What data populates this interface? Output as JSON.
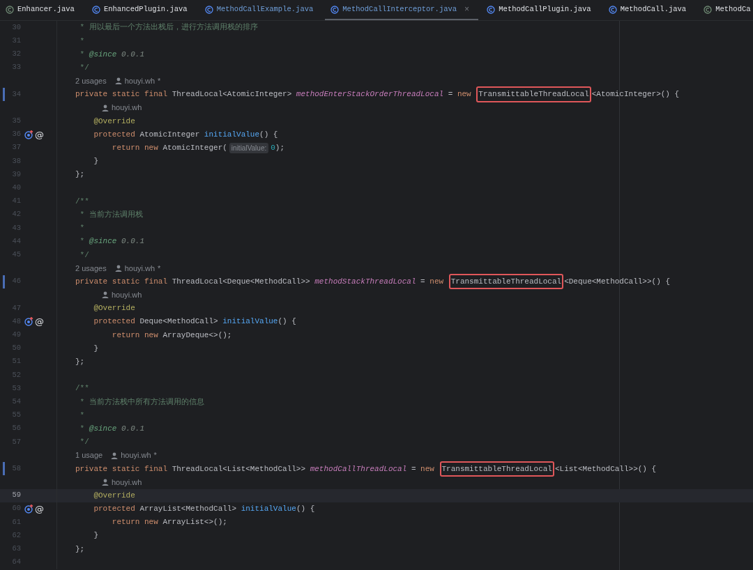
{
  "tabs": [
    {
      "label": "Enhancer.java",
      "kind": "other",
      "modified": false,
      "selected": false
    },
    {
      "label": "EnhancedPlugin.java",
      "kind": "class",
      "modified": false,
      "selected": false
    },
    {
      "label": "MethodCallExample.java",
      "kind": "class",
      "modified": true,
      "selected": false
    },
    {
      "label": "MethodCallInterceptor.java",
      "kind": "class",
      "modified": true,
      "selected": true,
      "close": "×"
    },
    {
      "label": "MethodCallPlugin.java",
      "kind": "class",
      "modified": false,
      "selected": false
    },
    {
      "label": "MethodCall.java",
      "kind": "class",
      "modified": false,
      "selected": false
    },
    {
      "label": "MethodCa",
      "kind": "other",
      "modified": false,
      "selected": false
    }
  ],
  "lines": [
    {
      "kind": "code",
      "number": "30",
      "tokens": [
        {
          "kind": "doc",
          "text": " * 用以最后一个方法出栈后，进行方法调用栈的排序"
        }
      ]
    },
    {
      "kind": "code",
      "number": "31",
      "tokens": [
        {
          "kind": "doc",
          "text": " *"
        }
      ]
    },
    {
      "kind": "code",
      "number": "32",
      "tokens": [
        {
          "kind": "doc",
          "text": " * "
        },
        {
          "kind": "doctag",
          "text": "@since"
        },
        {
          "kind": "docval",
          "text": " 0.0.1"
        }
      ]
    },
    {
      "kind": "code",
      "number": "33",
      "tokens": [
        {
          "kind": "doc",
          "text": " */"
        }
      ]
    },
    {
      "kind": "hint",
      "usages": "2 usages",
      "author": "houyi.wh",
      "mark": "*"
    },
    {
      "kind": "code",
      "number": "34",
      "changed": true,
      "tokens": [
        {
          "kind": "kw",
          "text": "private static final "
        },
        {
          "kind": "plain",
          "text": "ThreadLocal<AtomicInteger> "
        },
        {
          "kind": "field",
          "text": "methodEnterStackOrderThreadLocal"
        },
        {
          "kind": "plain",
          "text": " = "
        },
        {
          "kind": "kw",
          "text": "new "
        },
        {
          "kind": "plain",
          "text": "TransmittableThreadLocal",
          "boxed": true
        },
        {
          "kind": "plain",
          "text": "<AtomicInteger>() {"
        }
      ]
    },
    {
      "kind": "hint",
      "nested": true,
      "author": "houyi.wh"
    },
    {
      "kind": "code",
      "number": "35",
      "tokens": [
        {
          "kind": "ann",
          "text": "    @Override"
        }
      ]
    },
    {
      "kind": "code",
      "number": "36",
      "override": true,
      "annotation": "@",
      "tokens": [
        {
          "kind": "kw",
          "text": "    protected "
        },
        {
          "kind": "plain",
          "text": "AtomicInteger "
        },
        {
          "kind": "method",
          "text": "initialValue"
        },
        {
          "kind": "plain",
          "text": "() {"
        }
      ]
    },
    {
      "kind": "code",
      "number": "37",
      "tokens": [
        {
          "kind": "kw",
          "text": "        return new "
        },
        {
          "kind": "plain",
          "text": "AtomicInteger("
        },
        {
          "kind": "hint",
          "text": "initialValue:"
        },
        {
          "kind": "num",
          "text": "0"
        },
        {
          "kind": "plain",
          "text": ");"
        }
      ]
    },
    {
      "kind": "code",
      "number": "38",
      "tokens": [
        {
          "kind": "plain",
          "text": "    }"
        }
      ]
    },
    {
      "kind": "code",
      "number": "39",
      "tokens": [
        {
          "kind": "plain",
          "text": "};"
        }
      ]
    },
    {
      "kind": "code",
      "number": "40"
    },
    {
      "kind": "code",
      "number": "41",
      "tokens": [
        {
          "kind": "doc",
          "text": "/**"
        }
      ]
    },
    {
      "kind": "code",
      "number": "42",
      "tokens": [
        {
          "kind": "doc",
          "text": " * 当前方法调用栈"
        }
      ]
    },
    {
      "kind": "code",
      "number": "43",
      "tokens": [
        {
          "kind": "doc",
          "text": " *"
        }
      ]
    },
    {
      "kind": "code",
      "number": "44",
      "tokens": [
        {
          "kind": "doc",
          "text": " * "
        },
        {
          "kind": "doctag",
          "text": "@since"
        },
        {
          "kind": "docval",
          "text": " 0.0.1"
        }
      ]
    },
    {
      "kind": "code",
      "number": "45",
      "tokens": [
        {
          "kind": "doc",
          "text": " */"
        }
      ]
    },
    {
      "kind": "hint",
      "usages": "2 usages",
      "author": "houyi.wh",
      "mark": "*"
    },
    {
      "kind": "code",
      "number": "46",
      "changed": true,
      "tokens": [
        {
          "kind": "kw",
          "text": "private static final "
        },
        {
          "kind": "plain",
          "text": "ThreadLocal<Deque<MethodCall>> "
        },
        {
          "kind": "field",
          "text": "methodStackThreadLocal"
        },
        {
          "kind": "plain",
          "text": " = "
        },
        {
          "kind": "kw",
          "text": "new "
        },
        {
          "kind": "plain",
          "text": "TransmittableThreadLocal",
          "boxed": true
        },
        {
          "kind": "plain",
          "text": "<Deque<MethodCall>>() {"
        }
      ]
    },
    {
      "kind": "hint",
      "nested": true,
      "author": "houyi.wh"
    },
    {
      "kind": "code",
      "number": "47",
      "tokens": [
        {
          "kind": "ann",
          "text": "    @Override"
        }
      ]
    },
    {
      "kind": "code",
      "number": "48",
      "override": true,
      "annotation": "@",
      "tokens": [
        {
          "kind": "kw",
          "text": "    protected "
        },
        {
          "kind": "plain",
          "text": "Deque<MethodCall> "
        },
        {
          "kind": "method",
          "text": "initialValue"
        },
        {
          "kind": "plain",
          "text": "() {"
        }
      ]
    },
    {
      "kind": "code",
      "number": "49",
      "tokens": [
        {
          "kind": "kw",
          "text": "        return new "
        },
        {
          "kind": "plain",
          "text": "ArrayDeque<>();"
        }
      ]
    },
    {
      "kind": "code",
      "number": "50",
      "tokens": [
        {
          "kind": "plain",
          "text": "    }"
        }
      ]
    },
    {
      "kind": "code",
      "number": "51",
      "tokens": [
        {
          "kind": "plain",
          "text": "};"
        }
      ]
    },
    {
      "kind": "code",
      "number": "52"
    },
    {
      "kind": "code",
      "number": "53",
      "tokens": [
        {
          "kind": "doc",
          "text": "/**"
        }
      ]
    },
    {
      "kind": "code",
      "number": "54",
      "tokens": [
        {
          "kind": "doc",
          "text": " * 当前方法栈中所有方法调用的信息"
        }
      ]
    },
    {
      "kind": "code",
      "number": "55",
      "tokens": [
        {
          "kind": "doc",
          "text": " *"
        }
      ]
    },
    {
      "kind": "code",
      "number": "56",
      "tokens": [
        {
          "kind": "doc",
          "text": " * "
        },
        {
          "kind": "doctag",
          "text": "@since"
        },
        {
          "kind": "docval",
          "text": " 0.0.1"
        }
      ]
    },
    {
      "kind": "code",
      "number": "57",
      "tokens": [
        {
          "kind": "doc",
          "text": " */"
        }
      ]
    },
    {
      "kind": "hint",
      "usages": "1 usage",
      "author": "houyi.wh",
      "mark": "*"
    },
    {
      "kind": "code",
      "number": "58",
      "changed": true,
      "tokens": [
        {
          "kind": "kw",
          "text": "private static final "
        },
        {
          "kind": "plain",
          "text": "ThreadLocal<List<MethodCall>> "
        },
        {
          "kind": "field",
          "text": "methodCallThreadLocal"
        },
        {
          "kind": "plain",
          "text": " = "
        },
        {
          "kind": "kw",
          "text": "new "
        },
        {
          "kind": "plain",
          "text": "TransmittableThreadLocal",
          "boxed": true
        },
        {
          "kind": "plain",
          "text": "<List<MethodCall>>() {"
        }
      ]
    },
    {
      "kind": "hint",
      "nested": true,
      "author": "houyi.wh"
    },
    {
      "kind": "code",
      "number": "59",
      "current": true,
      "tokens": [
        {
          "kind": "ann",
          "text": "    @Override"
        }
      ]
    },
    {
      "kind": "code",
      "number": "60",
      "override": true,
      "annotation": "@",
      "tokens": [
        {
          "kind": "kw",
          "text": "    protected "
        },
        {
          "kind": "plain",
          "text": "ArrayList<MethodCall> "
        },
        {
          "kind": "method",
          "text": "initialValue"
        },
        {
          "kind": "plain",
          "text": "() {"
        }
      ]
    },
    {
      "kind": "code",
      "number": "61",
      "tokens": [
        {
          "kind": "kw",
          "text": "        return new "
        },
        {
          "kind": "plain",
          "text": "ArrayList<>();"
        }
      ]
    },
    {
      "kind": "code",
      "number": "62",
      "tokens": [
        {
          "kind": "plain",
          "text": "    }"
        }
      ]
    },
    {
      "kind": "code",
      "number": "63",
      "tokens": [
        {
          "kind": "plain",
          "text": "};"
        }
      ]
    },
    {
      "kind": "code",
      "number": "64"
    }
  ]
}
